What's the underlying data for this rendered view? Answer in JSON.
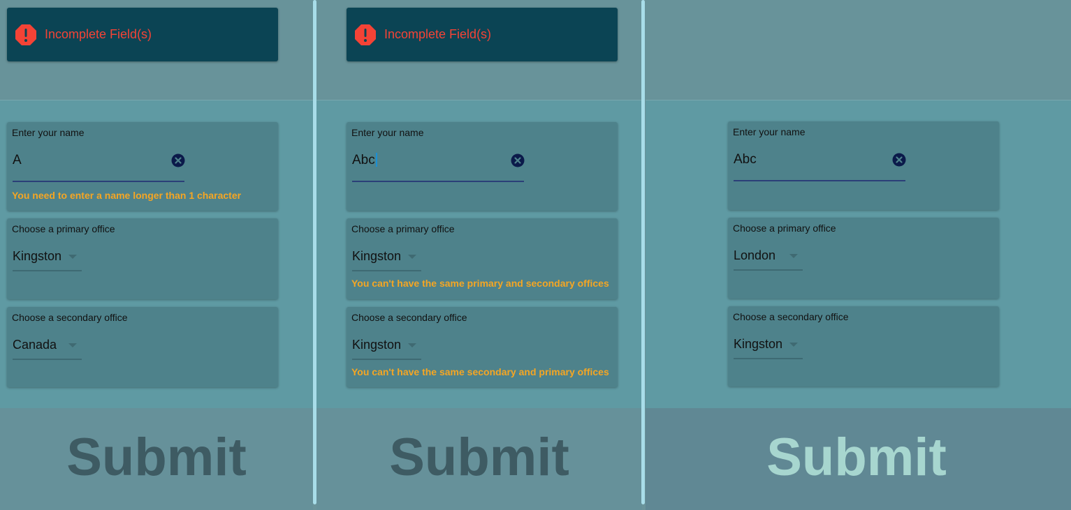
{
  "panels": [
    {
      "alert": {
        "visible": true,
        "text": "Incomplete Field(s)"
      },
      "name_field": {
        "label": "Enter your name",
        "value": "A",
        "error": "You need to enter a name longer than 1 character"
      },
      "primary_office": {
        "label": "Choose a primary office",
        "value": "Kingston",
        "error": ""
      },
      "secondary_office": {
        "label": "Choose a secondary office",
        "value": "Canada",
        "error": ""
      },
      "submit": {
        "label": "Submit",
        "enabled": false
      }
    },
    {
      "alert": {
        "visible": true,
        "text": "Incomplete Field(s)"
      },
      "name_field": {
        "label": "Enter your name",
        "value": "Abc",
        "error": ""
      },
      "primary_office": {
        "label": "Choose a primary office",
        "value": "Kingston",
        "error": "You can't have the same primary and secondary offices"
      },
      "secondary_office": {
        "label": "Choose a secondary office",
        "value": "Kingston",
        "error": "You can't have the same secondary and primary offices"
      },
      "submit": {
        "label": "Submit",
        "enabled": false
      }
    },
    {
      "alert": {
        "visible": false,
        "text": ""
      },
      "name_field": {
        "label": "Enter your name",
        "value": "Abc",
        "error": ""
      },
      "primary_office": {
        "label": "Choose a primary office",
        "value": "London",
        "error": ""
      },
      "secondary_office": {
        "label": "Choose a secondary office",
        "value": "Kingston",
        "error": ""
      },
      "submit": {
        "label": "Submit",
        "enabled": true
      }
    }
  ],
  "colors": {
    "alert_bg": "#0b4454",
    "alert_text": "#f44336",
    "error_text": "#f5a623",
    "card_bg": "#4e828b",
    "divider": "#a8dde9"
  },
  "icons": {
    "alert": "exclamation-octagon-icon",
    "clear": "clear-circle-icon",
    "dropdown": "caret-down-icon"
  }
}
